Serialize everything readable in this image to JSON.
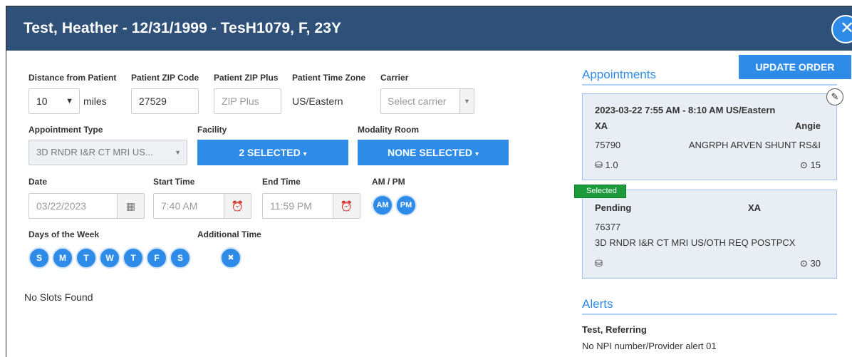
{
  "window": {
    "title": "Test, Heather - 12/31/1999 - TesH1079, F, 23Y",
    "close_glyph": "✕"
  },
  "search": {
    "distance": {
      "label": "Distance from Patient",
      "value": "10",
      "unit": "miles"
    },
    "zip": {
      "label": "Patient ZIP Code",
      "value": "27529"
    },
    "zip_plus": {
      "label": "Patient ZIP Plus",
      "placeholder": "ZIP Plus"
    },
    "time_zone": {
      "label": "Patient Time Zone",
      "value": "US/Eastern"
    },
    "carrier": {
      "label": "Carrier",
      "placeholder": "Select carrier"
    },
    "appointment_type": {
      "label": "Appointment Type",
      "value": "3D RNDR I&R CT MRI US..."
    },
    "facility": {
      "label": "Facility",
      "button": "2 SELECTED"
    },
    "modality_room": {
      "label": "Modality Room",
      "button": "NONE SELECTED"
    },
    "date": {
      "label": "Date",
      "value": "03/22/2023"
    },
    "start_time": {
      "label": "Start Time",
      "value": "7:40 AM"
    },
    "end_time": {
      "label": "End Time",
      "value": "11:59 PM"
    },
    "ampm": {
      "label": "AM / PM",
      "am": "AM",
      "pm": "PM"
    },
    "days": {
      "label": "Days of the Week",
      "items": [
        "S",
        "M",
        "T",
        "W",
        "T",
        "F",
        "S"
      ]
    },
    "additional_time": {
      "label": "Additional Time",
      "glyph": "✖"
    },
    "no_slots": "No Slots Found"
  },
  "toolbar": {
    "update_order": "UPDATE ORDER"
  },
  "appointments": {
    "title": "Appointments",
    "cards": [
      {
        "datetime": "2023-03-22  7:55 AM - 8:10 AM US/Eastern",
        "modality": "XA",
        "provider": "Angie",
        "code": "75790",
        "description": "ANGRPH ARVEN SHUNT RS&I",
        "weight": "1.0",
        "duration": "15"
      },
      {
        "badge": "Selected",
        "status": "Pending",
        "modality": "XA",
        "code": "76377",
        "description": "3D RNDR I&R CT MRI US/OTH REQ POSTPCX",
        "duration": "30"
      }
    ]
  },
  "alerts": {
    "title": "Alerts",
    "name": "Test, Referring",
    "message": "No NPI number/Provider alert 01"
  },
  "colors": {
    "header": "#2f5079",
    "accent": "#2e8be8",
    "selected": "#1c9b3a"
  }
}
